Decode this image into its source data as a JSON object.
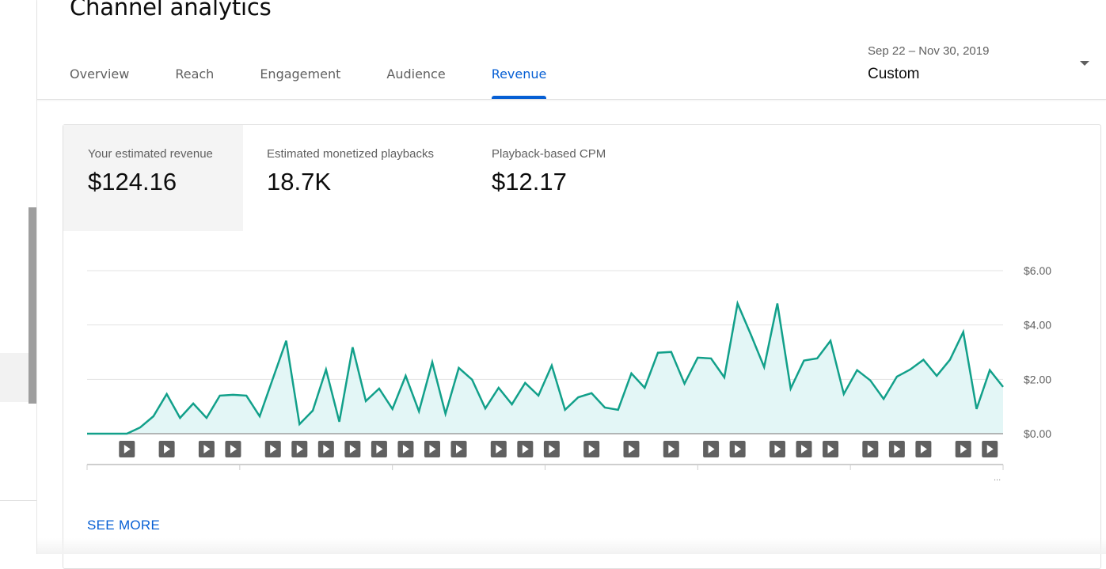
{
  "page": {
    "title": "Channel analytics",
    "tabs": [
      {
        "label": "Overview",
        "active": false
      },
      {
        "label": "Reach",
        "active": false
      },
      {
        "label": "Engagement",
        "active": false
      },
      {
        "label": "Audience",
        "active": false
      },
      {
        "label": "Revenue",
        "active": true
      }
    ],
    "date_picker": {
      "range": "Sep 22 – Nov 30, 2019",
      "label": "Custom",
      "icon": "dropdown-arrow-icon"
    }
  },
  "metrics": [
    {
      "label": "Your estimated revenue",
      "value": "$124.16",
      "active": true
    },
    {
      "label": "Estimated monetized playbacks",
      "value": "18.7K",
      "active": false
    },
    {
      "label": "Playback-based CPM",
      "value": "$12.17",
      "active": false
    }
  ],
  "see_more_label": "SEE MORE",
  "axis_overflow_label": "...",
  "colors": {
    "accent": "#065fd4",
    "line": "#12a08a",
    "area": "#e3f6f6",
    "video_marker": "#606060"
  },
  "chart_data": {
    "type": "area",
    "title": "Your estimated revenue",
    "xlabel": "",
    "ylabel": "",
    "x_start": "Sep 22, 2019",
    "x_end": "Nov 30, 2019",
    "y_ticks": [
      "$0.00",
      "$2.00",
      "$4.00",
      "$6.00"
    ],
    "ylim": [
      0,
      6
    ],
    "grid": true,
    "y_axis_position": "right",
    "series": [
      {
        "name": "Estimated revenue (USD)",
        "values": [
          0,
          0,
          0,
          0,
          0.23,
          0.64,
          1.46,
          0.58,
          1.11,
          0.58,
          1.4,
          1.43,
          1.4,
          0.64,
          2.04,
          3.42,
          0.35,
          0.85,
          2.36,
          0.44,
          3.18,
          1.2,
          1.66,
          0.91,
          2.13,
          0.82,
          2.63,
          0.73,
          2.42,
          1.99,
          0.93,
          1.69,
          1.08,
          1.87,
          1.4,
          2.51,
          0.88,
          1.34,
          1.49,
          0.96,
          0.88,
          2.22,
          1.69,
          2.98,
          3.01,
          1.84,
          2.8,
          2.77,
          2.07,
          4.79,
          3.65,
          2.45,
          4.79,
          1.66,
          2.69,
          2.77,
          3.42,
          1.46,
          2.34,
          1.96,
          1.28,
          2.1,
          2.36,
          2.72,
          2.13,
          2.72,
          3.74,
          0.91,
          2.34,
          1.72
        ]
      }
    ],
    "video_publish_day_indices": [
      3,
      6,
      9,
      11,
      14,
      16,
      18,
      20,
      22,
      24,
      26,
      28,
      31,
      33,
      35,
      38,
      41,
      44,
      47,
      49,
      52,
      54,
      56,
      59,
      61,
      63,
      66,
      68
    ],
    "x_axis_segments": 6
  }
}
